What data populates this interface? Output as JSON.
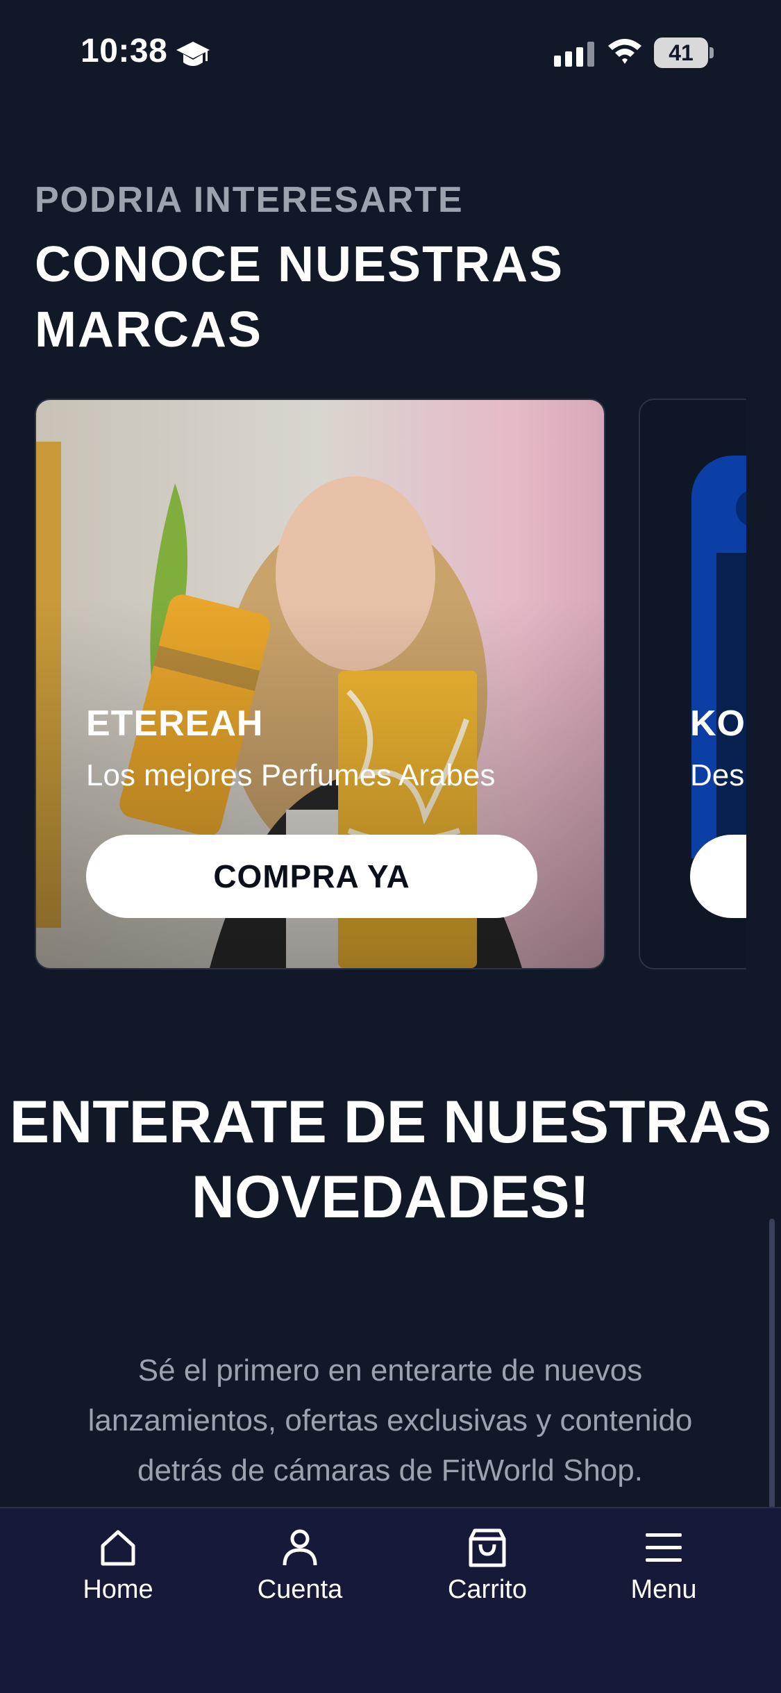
{
  "status_bar": {
    "time": "10:38",
    "battery": "41"
  },
  "section": {
    "eyebrow": "PODRIA INTERESARTE",
    "title": "CONOCE NUESTRAS MARCAS"
  },
  "brands": [
    {
      "name": "ETEREAH",
      "description": "Los mejores Perfumes Arabes",
      "button": "COMPRA YA"
    },
    {
      "name": "KO",
      "description": "Des",
      "button": ""
    }
  ],
  "news": {
    "title": "ENTERATE DE NUESTRAS NOVEDADES!",
    "text": "Sé el primero en enterarte de nuevos lanzamientos, ofertas exclusivas y contenido detrás de cámaras de FitWorld Shop."
  },
  "bottom_nav": [
    {
      "label": "Home",
      "icon": "home-icon"
    },
    {
      "label": "Cuenta",
      "icon": "user-icon"
    },
    {
      "label": "Carrito",
      "icon": "shopping-bag-icon"
    },
    {
      "label": "Menu",
      "icon": "menu-icon"
    }
  ],
  "colors": {
    "background": "#111827",
    "nav_background": "#141a37",
    "muted_text": "#9ca3af"
  }
}
